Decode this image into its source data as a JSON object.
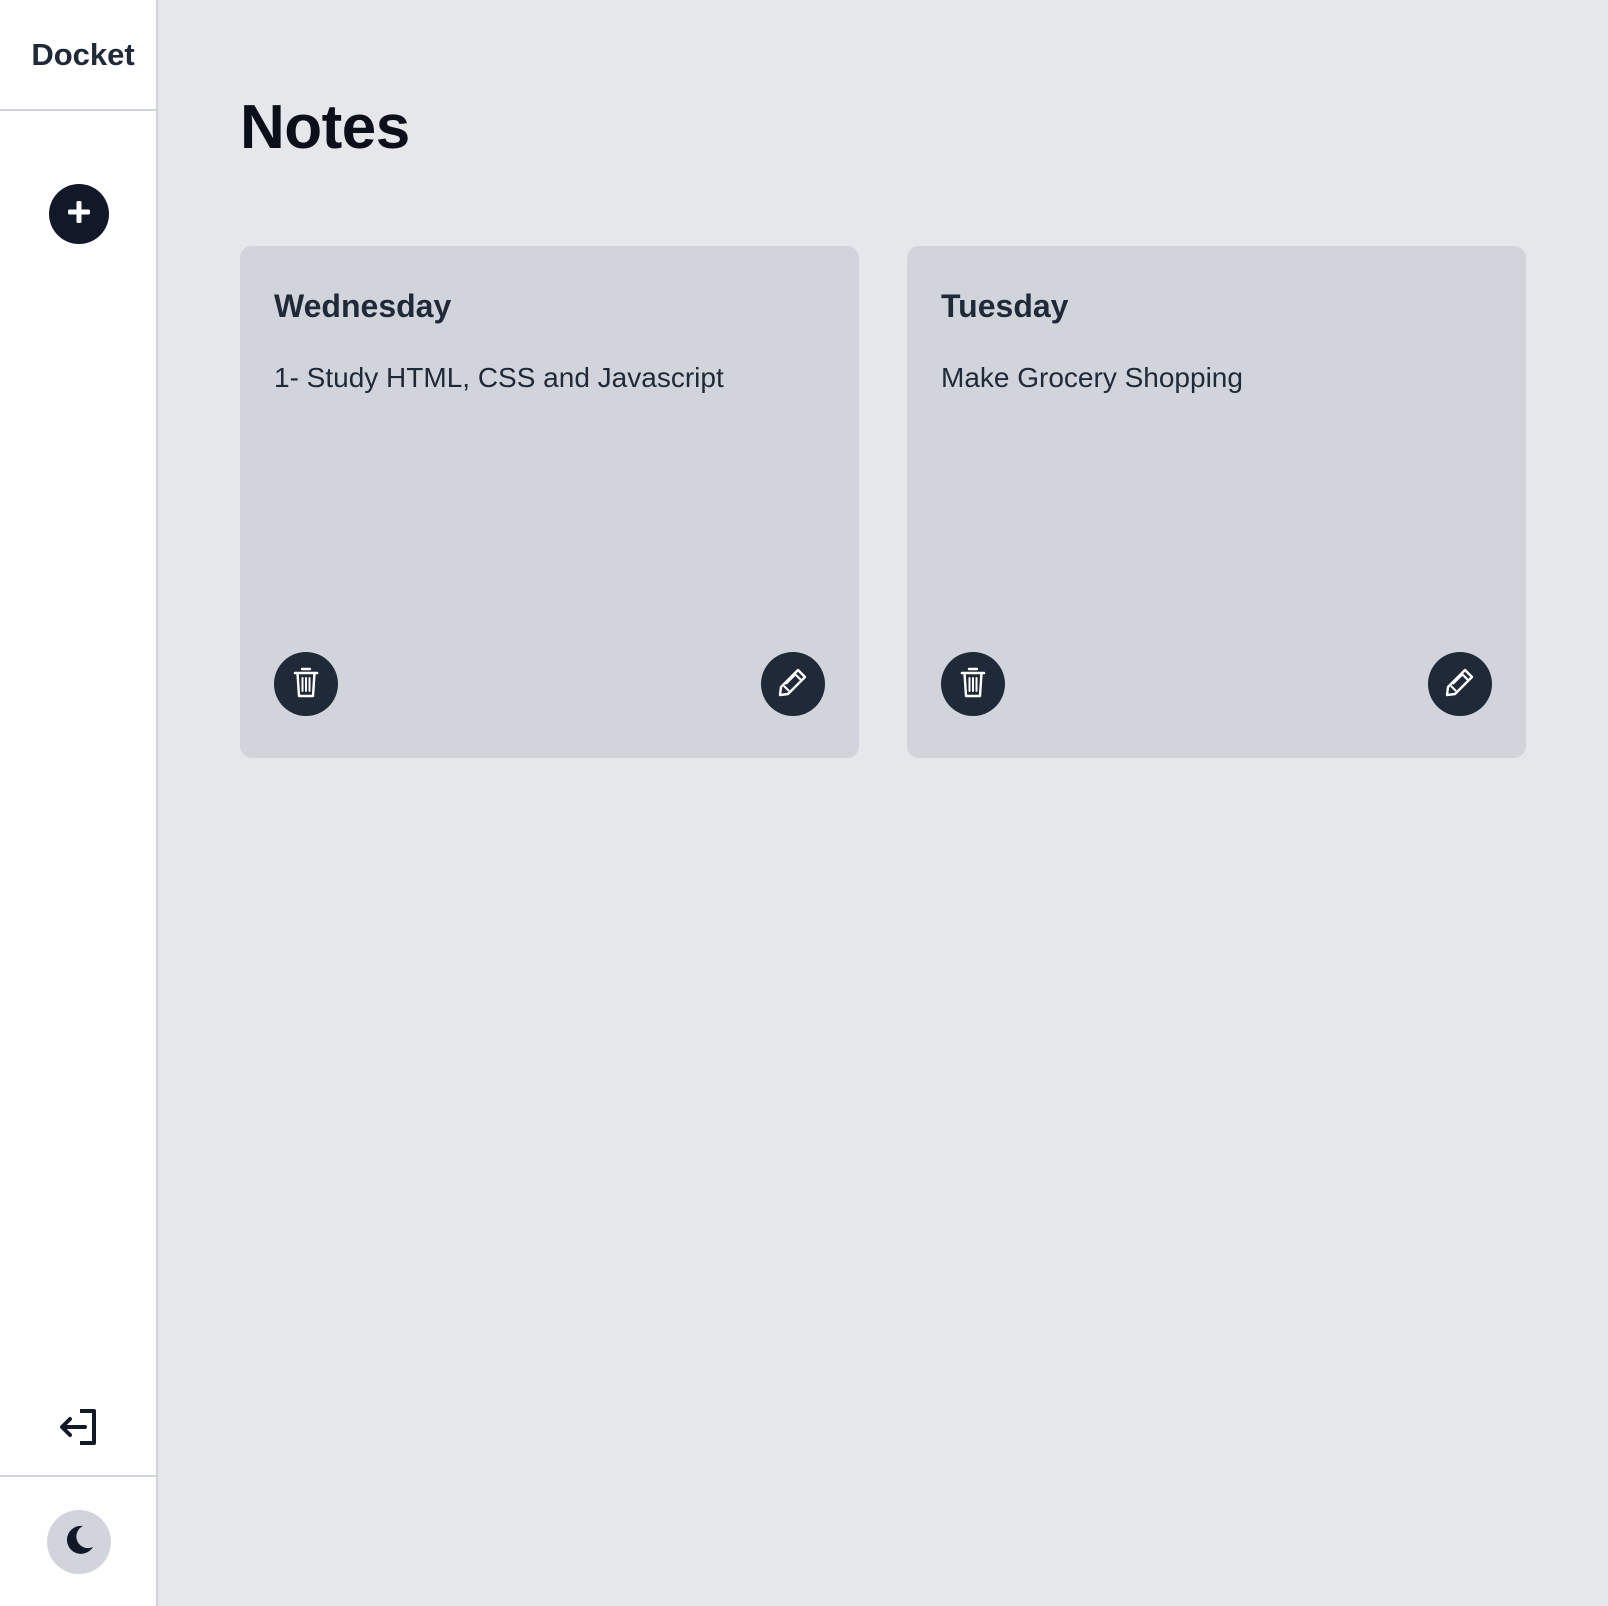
{
  "app": {
    "brand": "Docket"
  },
  "sidebar": {
    "add_icon": "plus-icon",
    "logout_icon": "logout-icon",
    "theme_icon": "moon-icon"
  },
  "main": {
    "title": "Notes",
    "notes": [
      {
        "title": "Wednesday",
        "body": "1- Study HTML, CSS and Javascript",
        "delete_icon": "trash-icon",
        "edit_icon": "pencil-icon"
      },
      {
        "title": "Tuesday",
        "body": "Make Grocery Shopping",
        "delete_icon": "trash-icon",
        "edit_icon": "pencil-icon"
      }
    ]
  },
  "colors": {
    "background": "#e5e7eb",
    "sidebar": "#ffffff",
    "card": "#d1d5db",
    "button_dark": "#1f2937",
    "text": "#1f2937"
  }
}
